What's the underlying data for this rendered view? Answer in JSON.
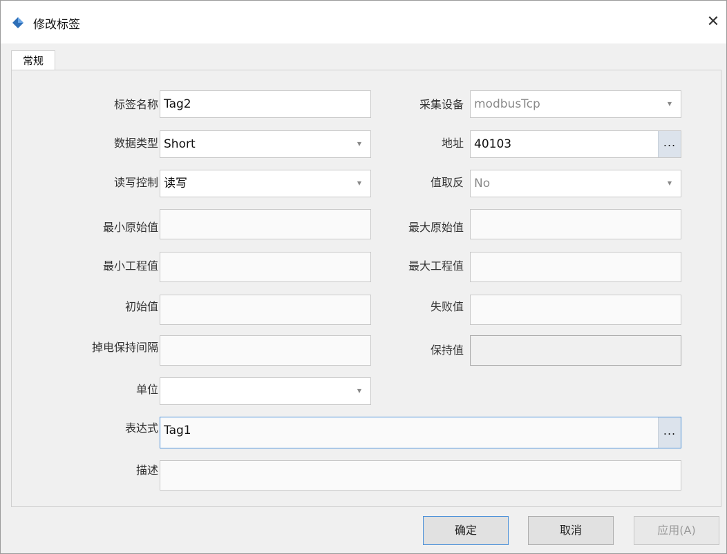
{
  "window": {
    "title": "修改标签",
    "close_glyph": "✕"
  },
  "tabs": [
    {
      "label": "常规"
    }
  ],
  "form": {
    "tag_name": {
      "label": "标签名称",
      "value": "Tag2"
    },
    "device": {
      "label": "采集设备",
      "value": "modbusTcp"
    },
    "data_type": {
      "label": "数据类型",
      "value": "Short"
    },
    "address": {
      "label": "地址",
      "value": "40103"
    },
    "rw_control": {
      "label": "读写控制",
      "value": "读写"
    },
    "invert": {
      "label": "值取反",
      "value": "No"
    },
    "min_raw": {
      "label": "最小原始值",
      "value": ""
    },
    "max_raw": {
      "label": "最大原始值",
      "value": ""
    },
    "min_eng": {
      "label": "最小工程值",
      "value": ""
    },
    "max_eng": {
      "label": "最大工程值",
      "value": ""
    },
    "initial": {
      "label": "初始值",
      "value": ""
    },
    "fail_value": {
      "label": "失败值",
      "value": ""
    },
    "hold_interval": {
      "label": "掉电保持间隔",
      "value": ""
    },
    "hold_value": {
      "label": "保持值",
      "value": ""
    },
    "unit": {
      "label": "单位",
      "value": ""
    },
    "expression": {
      "label": "表达式",
      "value": "Tag1"
    },
    "description": {
      "label": "描述",
      "value": ""
    }
  },
  "icons": {
    "dropdown_arrow": "▼",
    "browse_dots": "..."
  },
  "buttons": {
    "ok": "确定",
    "cancel": "取消",
    "apply": "应用(A)"
  },
  "colors": {
    "accent": "#4a90d9",
    "title_icon": "#2e6fb8"
  }
}
